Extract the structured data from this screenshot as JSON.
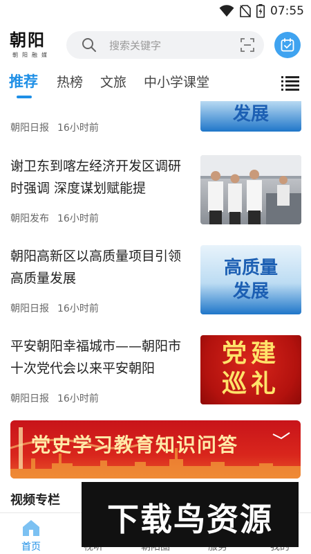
{
  "status_bar": {
    "time": "07:55",
    "icons": [
      "wifi-icon",
      "no-sim-icon",
      "battery-charging-icon"
    ]
  },
  "header": {
    "logo_text": "朝阳",
    "logo_sub": "朝阳融媒",
    "search_placeholder": "搜索关键字",
    "icons": [
      "search-icon",
      "scan-icon",
      "calendar-icon"
    ],
    "accent_color": "#3fa3f0"
  },
  "tabs": [
    {
      "label": "推荐",
      "active": true
    },
    {
      "label": "热榜",
      "active": false
    },
    {
      "label": "文旅",
      "active": false
    },
    {
      "label": "中小学课堂",
      "active": false
    }
  ],
  "feed": {
    "items": [
      {
        "title": "",
        "source": "朝阳日报",
        "time": "16小时前",
        "thumb_text": "发展"
      },
      {
        "title": "谢卫东到喀左经济开发区调研时强调 深度谋划赋能提",
        "source": "朝阳发布",
        "time": "16小时前",
        "thumb_text": ""
      },
      {
        "title": "朝阳高新区以高质量项目引领高质量发展",
        "source": "朝阳日报",
        "time": "16小时前",
        "thumb_text_1": "高质量",
        "thumb_text_2": "发展"
      },
      {
        "title": "平安朝阳幸福城市——朝阳市十次党代会以来平安朝阳",
        "source": "朝阳日报",
        "time": "16小时前",
        "thumb_text_1": "党建",
        "thumb_text_2": "巡礼"
      }
    ],
    "banner_text": "党史学习教育知识问答",
    "section_title": "视频专栏"
  },
  "bottom_nav": [
    {
      "label": "首页",
      "icon": "home-icon",
      "active": true
    },
    {
      "label": "视听",
      "icon": "video-icon",
      "active": false
    },
    {
      "label": "朝阳圈",
      "icon": "circle-icon",
      "active": false
    },
    {
      "label": "服务",
      "icon": "service-icon",
      "active": false
    },
    {
      "label": "我的",
      "icon": "profile-icon",
      "active": false
    }
  ],
  "watermark": {
    "text": "下载鸟资源"
  }
}
